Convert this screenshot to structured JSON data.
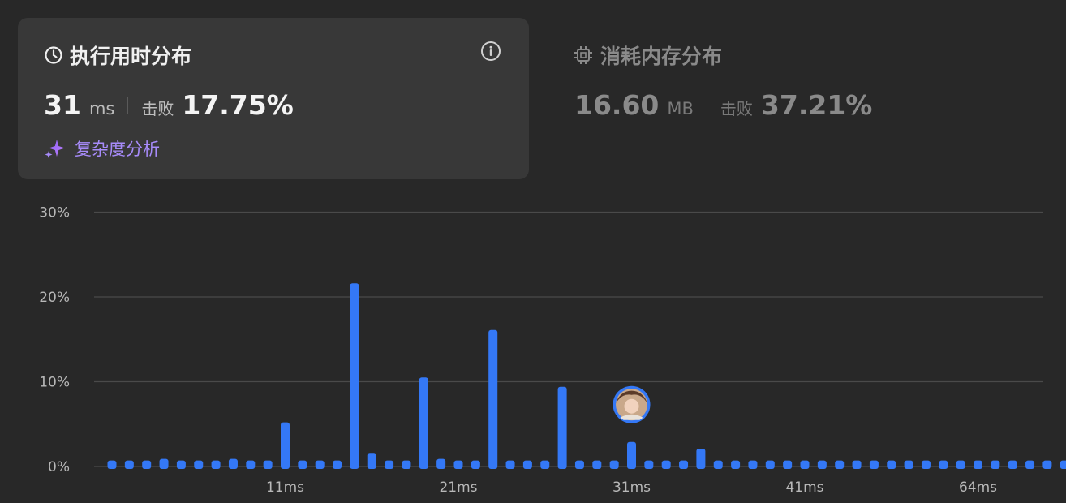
{
  "runtime_card": {
    "title": "执行用时分布",
    "value": "31",
    "unit": "ms",
    "beats_label": "击败",
    "beats_value": "17.75%",
    "complexity_link": "复杂度分析"
  },
  "memory_card": {
    "title": "消耗内存分布",
    "value": "16.60",
    "unit": "MB",
    "beats_label": "击败",
    "beats_value": "37.21%"
  },
  "colors": {
    "bar": "#3478f6",
    "accent": "#a78bfa",
    "grid": "#4a4a4a"
  },
  "chart_data": {
    "type": "bar",
    "y_tick_labels": [
      "0%",
      "10%",
      "20%",
      "30%"
    ],
    "ylim": [
      0,
      30
    ],
    "x_tick_labels": [
      {
        "index": 10,
        "label": "11ms"
      },
      {
        "index": 20,
        "label": "21ms"
      },
      {
        "index": 30,
        "label": "31ms"
      },
      {
        "index": 40,
        "label": "41ms"
      },
      {
        "index": 50,
        "label": "64ms"
      }
    ],
    "values": [
      0.7,
      0.7,
      0.7,
      0.9,
      0.7,
      0.7,
      0.7,
      0.9,
      0.7,
      0.7,
      5.2,
      0.7,
      0.7,
      0.7,
      21.6,
      1.6,
      0.7,
      0.7,
      10.5,
      0.9,
      0.7,
      0.7,
      16.1,
      0.7,
      0.7,
      0.7,
      9.4,
      0.7,
      0.7,
      0.7,
      2.9,
      0.7,
      0.7,
      0.7,
      2.1,
      0.7,
      0.7,
      0.7,
      0.7,
      0.7,
      0.7,
      0.7,
      0.7,
      0.7,
      0.7,
      0.7,
      0.7,
      0.7,
      0.7,
      0.7,
      0.7,
      0.7,
      0.7,
      0.7,
      0.7,
      0.7,
      0.7
    ],
    "user_index": 30,
    "grid": true
  }
}
